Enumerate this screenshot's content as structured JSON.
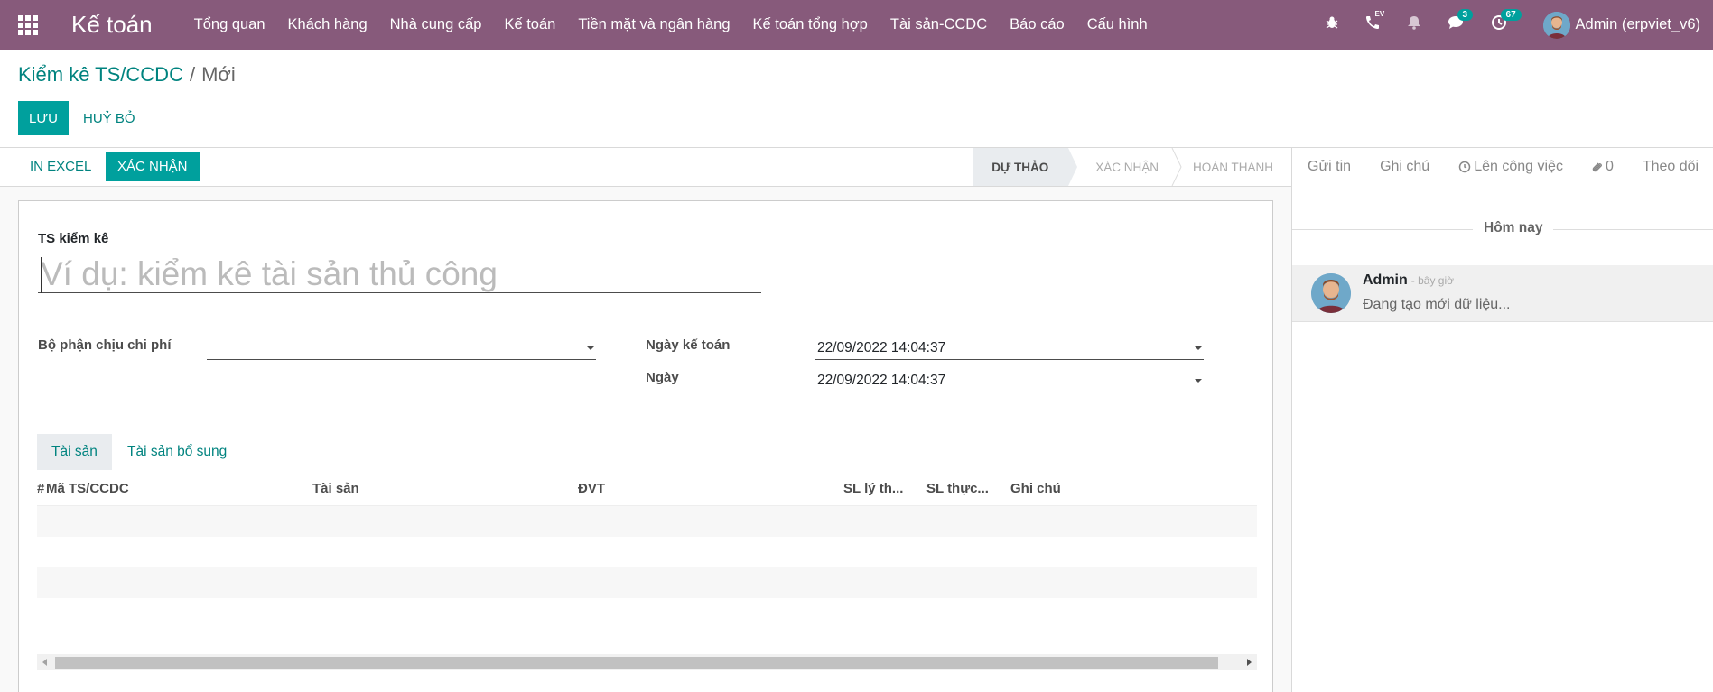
{
  "navbar": {
    "brand": "Kế toán",
    "menu": [
      "Tổng quan",
      "Khách hàng",
      "Nhà cung cấp",
      "Kế toán",
      "Tiền mặt và ngân hàng",
      "Kế toán tổng hợp",
      "Tài sản-CCDC",
      "Báo cáo",
      "Cấu hình"
    ],
    "voip_label": "EV",
    "messages_count": "3",
    "activities_count": "67",
    "user": "Admin (erpviet_v6)"
  },
  "breadcrumb": {
    "parent": "Kiểm kê TS/CCDC",
    "separator": "/",
    "current": "Mới"
  },
  "actions": {
    "save": "LƯU",
    "discard": "HUỶ BỎ"
  },
  "statusbar": {
    "excel": "IN EXCEL",
    "confirm": "XÁC NHẬN",
    "stages": [
      "DỰ THẢO",
      "XÁC NHẬN",
      "HOÀN THÀNH"
    ],
    "active_stage": "DỰ THẢO"
  },
  "form": {
    "title_label": "TS kiểm kê",
    "title_placeholder": "Ví dụ: kiểm kê tài sản thủ công",
    "cost_center_label": "Bộ phận chịu chi phí",
    "cost_center_value": "",
    "accounting_date_label": "Ngày kế toán",
    "accounting_date_value": "22/09/2022 14:04:37",
    "date_label": "Ngày",
    "date_value": "22/09/2022 14:04:37"
  },
  "tabs": [
    "Tài sản",
    "Tài sản bổ sung"
  ],
  "table": {
    "columns": [
      "#",
      "Mã TS/CCDC",
      "Tài sản",
      "ĐVT",
      "SL lý th...",
      "SL thực...",
      "Ghi chú"
    ]
  },
  "chatter": {
    "send_message": "Gửi tin",
    "log_note": "Ghi chú",
    "schedule": "Lên công việc",
    "attachments": "0",
    "follow": "Theo dõi",
    "date_separator": "Hôm nay",
    "message": {
      "author": "Admin",
      "time": "- bây giờ",
      "body": "Đang tạo mới dữ liệu..."
    }
  }
}
